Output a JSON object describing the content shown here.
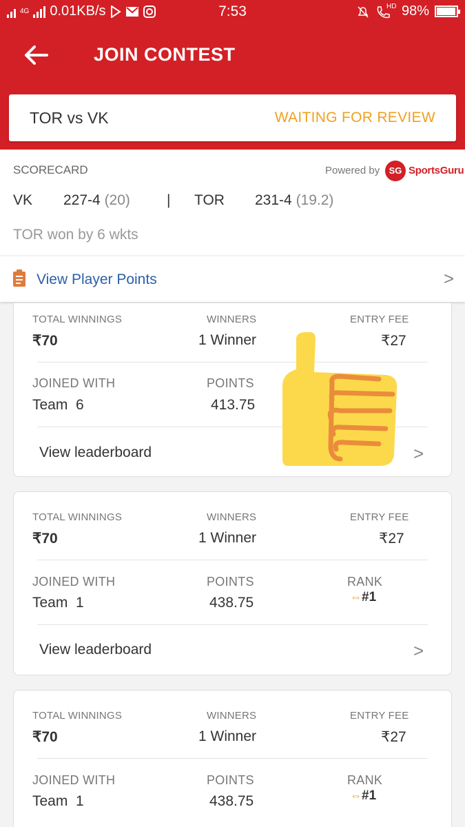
{
  "status_bar": {
    "network": "4G",
    "speed": "0.01KB/s",
    "time": "7:53",
    "hd": "HD",
    "battery": "98%",
    "battery_level": 0.98
  },
  "header": {
    "title": "JOIN CONTEST",
    "match": "TOR vs VK",
    "status": "WAITING FOR REVIEW"
  },
  "scorecard": {
    "label": "SCORECARD",
    "powered_by": "Powered by",
    "logo_text": "SG",
    "brand": "SportsGuru",
    "team1": {
      "name": "VK",
      "score": "227-4",
      "overs": "(20)"
    },
    "separator": "|",
    "team2": {
      "name": "TOR",
      "score": "231-4",
      "overs": "(19.2)"
    },
    "result": "TOR won by 6 wkts"
  },
  "player_points": {
    "label": "View Player Points",
    "chevron": ">"
  },
  "contests": [
    {
      "total_winnings_label": "TOTAL WINNINGS",
      "total_winnings": "₹70",
      "winners_label": "WINNERS",
      "winners": "1 Winner",
      "entry_fee_label": "ENTRY FEE",
      "entry_fee": "₹27",
      "joined_label": "JOINED WITH",
      "joined": "Team  6",
      "points_label": "POINTS",
      "points": "413.75",
      "leaderboard": "View leaderboard",
      "chevron": ">"
    },
    {
      "total_winnings_label": "TOTAL WINNINGS",
      "total_winnings": "₹70",
      "winners_label": "WINNERS",
      "winners": "1 Winner",
      "entry_fee_label": "ENTRY FEE",
      "entry_fee": "₹27",
      "joined_label": "JOINED WITH",
      "joined": "Team  1",
      "points_label": "POINTS",
      "points": "438.75",
      "rank_label": "RANK",
      "rank": "#1",
      "leaderboard": "View leaderboard",
      "chevron": ">"
    },
    {
      "total_winnings_label": "TOTAL WINNINGS",
      "total_winnings": "₹70",
      "winners_label": "WINNERS",
      "winners": "1 Winner",
      "entry_fee_label": "ENTRY FEE",
      "entry_fee": "₹27",
      "joined_label": "JOINED WITH",
      "joined": "Team  1",
      "points_label": "POINTS",
      "points": "438.75",
      "rank_label": "RANK",
      "rank": "#1"
    }
  ],
  "colors": {
    "brand_red": "#d32026",
    "status_orange": "#f0a01e",
    "link_blue": "#2b5fa8"
  },
  "icons": [
    "back-arrow-icon",
    "signal-icon",
    "play-store-icon",
    "mail-icon",
    "instagram-icon",
    "bell-mute-icon",
    "phone-hd-icon",
    "battery-icon",
    "clipboard-icon",
    "chevron-right-icon",
    "rank-arrows-icon",
    "thumbs-up-emoji"
  ]
}
